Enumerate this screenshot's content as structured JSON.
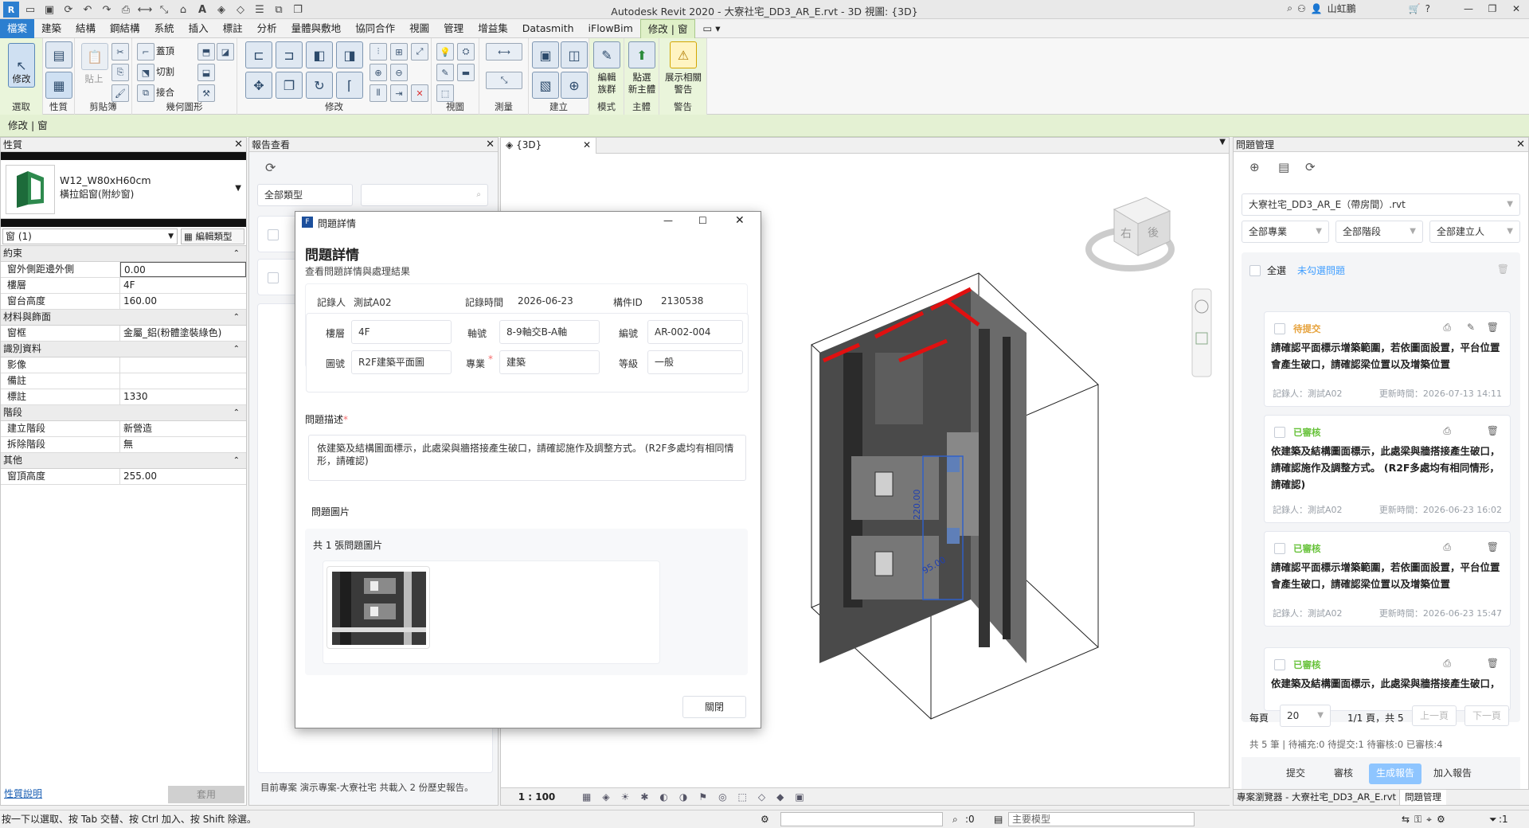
{
  "app": {
    "title": "Autodesk Revit 2020 - 大寮社宅_DD3_AR_E.rvt - 3D 視圖: {3D}",
    "user": "山虹鵬"
  },
  "menu": {
    "tabs": [
      "檔案",
      "建築",
      "結構",
      "鋼結構",
      "系統",
      "插入",
      "標註",
      "分析",
      "量體與敷地",
      "協同合作",
      "視圖",
      "管理",
      "增益集",
      "Datasmith",
      "iFlowBim",
      "修改 | 窗"
    ]
  },
  "ribbon": {
    "select_label": "選取",
    "modify_label": "修改",
    "properties_label": "性質",
    "clipboard_label": "剪貼簿",
    "paste_label": "貼上",
    "cut_label": "切割",
    "cope_label": "蓋頂",
    "join_label": "接合",
    "geometry_label": "幾何圖形",
    "modify_group_label": "修改",
    "view_label": "視圖",
    "measure_label": "測量",
    "create_label": "建立",
    "edit_family_label": "編輯\n族群",
    "mode_label": "模式",
    "pick_host_label": "點選\n新主體",
    "host_label": "主體",
    "show_warnings_label": "展示相關\n警告",
    "warning_label": "警告"
  },
  "context_bar": {
    "label": "修改 | 窗"
  },
  "properties": {
    "title": "性質",
    "type_name": "W12_W80xH60cm",
    "type_sub": "橫拉鋁窗(附紗窗)",
    "selector": "窗 (1)",
    "edit_type": "編輯類型",
    "help_link": "性質說明",
    "apply": "套用",
    "sections": [
      {
        "name": "約束",
        "rows": [
          [
            "窗外側距邊外側",
            "0.00"
          ],
          [
            "樓層",
            "4F"
          ],
          [
            "窗台高度",
            "160.00"
          ]
        ]
      },
      {
        "name": "材料與飾面",
        "rows": [
          [
            "窗框",
            "金屬_鋁(粉體塗裝綠色)"
          ]
        ]
      },
      {
        "name": "識別資料",
        "rows": [
          [
            "影像",
            ""
          ],
          [
            "備註",
            ""
          ],
          [
            "標註",
            "1330"
          ]
        ]
      },
      {
        "name": "階段",
        "rows": [
          [
            "建立階段",
            "新營造"
          ],
          [
            "拆除階段",
            "無"
          ]
        ]
      },
      {
        "name": "其他",
        "rows": [
          [
            "窗頂高度",
            "255.00"
          ]
        ]
      }
    ]
  },
  "report": {
    "title": "報告查看",
    "filter_label": "全部類型",
    "footer": "目前專案 演示專案-大寮社宅 共載入 2 份歷史報告。"
  },
  "view": {
    "tab_label": "{3D}",
    "scale": "1 : 100",
    "dims": [
      "220.00",
      "95.00"
    ],
    "cube_faces": [
      "右",
      "後"
    ]
  },
  "dialog": {
    "window_title": "問題詳情",
    "heading": "問題詳情",
    "subheading": "查看問題詳情與處理結果",
    "recorder_label": "記錄人",
    "recorder": "測試A02",
    "time_label": "記錄時間",
    "time": "2026-06-23",
    "component_label": "構件ID",
    "component": "2130538",
    "floor_label": "樓層",
    "floor": "4F",
    "axis_label": "軸號",
    "axis": "8-9軸交B-A軸",
    "code_label": "編號",
    "code": "AR-002-004",
    "drawing_label": "圖號",
    "drawing": "R2F建築平面圖",
    "discipline_label": "專業",
    "discipline": "建築",
    "level_label": "等級",
    "level": "一般",
    "desc_label": "問題描述",
    "desc": "依建築及結構圖面標示，此處梁與牆搭接產生破口，請確認施作及調整方式。 (R2F多處均有相同情形，請確認)",
    "image_label": "問題圖片",
    "image_count": "共 1 張問題圖片",
    "close_button": "關閉"
  },
  "issues": {
    "title": "問題管理",
    "project": "大寮社宅_DD3_AR_E（帶房間）.rvt",
    "filters": [
      "全部專業",
      "全部階段",
      "全部建立人"
    ],
    "select_all": "全選",
    "unchecked_link": "未勾選問題",
    "cards": [
      {
        "status": "待提交",
        "status_color": "#e6a23c",
        "text": "請確認平面標示增築範圍，若依圖面設置，平台位置會產生破口，請確認梁位置以及增築位置",
        "recorder": "記錄人：測試A02",
        "updated": "更新時間：2026-07-13 14:11"
      },
      {
        "status": "已審核",
        "status_color": "#67c23a",
        "text": "依建築及結構圖面標示，此處梁與牆搭接產生破口，請確認施作及調整方式。 (R2F多處均有相同情形，請確認)",
        "recorder": "記錄人：測試A02",
        "updated": "更新時間：2026-06-23 16:02"
      },
      {
        "status": "已審核",
        "status_color": "#67c23a",
        "text": "請確認平面標示增築範圍，若依圖面設置，平台位置會產生破口，請確認梁位置以及增築位置",
        "recorder": "記錄人：測試A02",
        "updated": "更新時間：2026-06-23 15:47"
      },
      {
        "status": "已審核",
        "status_color": "#67c23a",
        "text": "依建築及結構圖面標示，此處梁與牆搭接產生破口，",
        "recorder": "",
        "updated": ""
      }
    ],
    "per_page_label": "每頁",
    "per_page": "20",
    "page_info": "1/1 頁，共 5",
    "prev": "上一頁",
    "next": "下一頁",
    "summary": "共 5 筆 | 待補充:0 待提交:1 待審核:0 已審核:4",
    "buttons": [
      "提交",
      "審核",
      "生成報告",
      "加入報告"
    ],
    "tabs": [
      "專案瀏覽器 - 大寮社宅_DD3_AR_E.rvt",
      "問題管理"
    ]
  },
  "status": {
    "hint": "按一下以選取、按 Tab 交替、按 Ctrl 加入、按 Shift 除選。",
    "zero": ":0",
    "model": "主要模型",
    "filter_count": ":1"
  },
  "colors": {
    "accent": "#409eff",
    "ribbon_green": "#e4f1d3",
    "file_tab": "#2c7fd0"
  }
}
